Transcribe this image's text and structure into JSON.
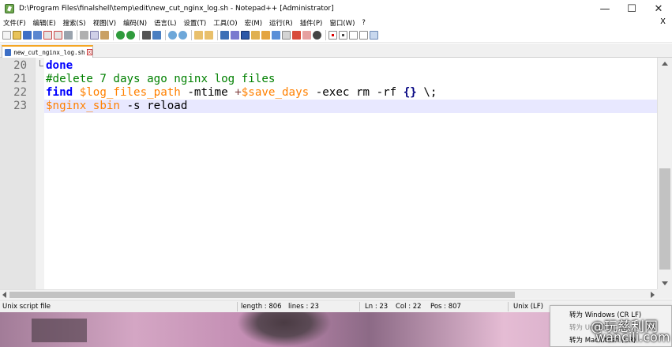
{
  "window": {
    "title": "D:\\Program Files\\finalshell\\temp\\edit\\new_cut_nginx_log.sh - Notepad++ [Administrator]",
    "minimize": "—",
    "maximize": "☐",
    "close": "✕"
  },
  "menu": {
    "items": [
      "文件(F)",
      "编辑(E)",
      "搜索(S)",
      "视图(V)",
      "编码(N)",
      "语言(L)",
      "设置(T)",
      "工具(O)",
      "宏(M)",
      "运行(R)",
      "插件(P)",
      "窗口(W)",
      "?"
    ],
    "close": "X"
  },
  "toolbar": {
    "icons": [
      "new-file-icon",
      "open-file-icon",
      "save-icon",
      "save-all-icon",
      "close-icon",
      "close-all-icon",
      "print-icon",
      "cut-icon",
      "copy-icon",
      "paste-icon",
      "undo-icon",
      "redo-icon",
      "find-icon",
      "replace-icon",
      "zoom-in-icon",
      "zoom-out-icon",
      "sync-vertical-icon",
      "sync-horizontal-icon",
      "word-wrap-icon",
      "show-all-chars-icon",
      "indent-guide-icon",
      "udl-icon",
      "doc-map-icon",
      "function-list-icon",
      "folder-workspace-icon",
      "monitoring-icon",
      "record-macro-icon",
      "stop-macro-icon",
      "play-macro-icon",
      "run-macro-icon",
      "save-macro-icon"
    ]
  },
  "tab": {
    "label": "new_cut_nginx_log.sh",
    "close": "x"
  },
  "editor": {
    "lines": [
      {
        "num": "20",
        "tokens": [
          {
            "t": "done",
            "c": "kw"
          }
        ]
      },
      {
        "num": "21",
        "tokens": [
          {
            "t": "#delete 7 days ago nginx log files",
            "c": "cm"
          }
        ]
      },
      {
        "num": "22",
        "tokens": [
          {
            "t": "find",
            "c": "kw"
          },
          {
            "t": " ",
            "c": "txt"
          },
          {
            "t": "$log_files_path",
            "c": "var"
          },
          {
            "t": " -mtime ",
            "c": "txt"
          },
          {
            "t": "+",
            "c": "op"
          },
          {
            "t": "$save_days",
            "c": "var"
          },
          {
            "t": " -exec rm -rf ",
            "c": "txt"
          },
          {
            "t": "{}",
            "c": "brace"
          },
          {
            "t": " \\;",
            "c": "txt"
          }
        ]
      },
      {
        "num": "23",
        "tokens": [
          {
            "t": "$nginx_sbin",
            "c": "var"
          },
          {
            "t": " -s reload",
            "c": "txt"
          }
        ]
      }
    ]
  },
  "status": {
    "filetype": "Unix script file",
    "length": "length : 806",
    "lines": "lines : 23",
    "ln": "Ln : 23",
    "col": "Col : 22",
    "pos": "Pos : 807",
    "eol": "Unix (LF)"
  },
  "context_menu": {
    "items": [
      {
        "label": "转为 Windows (CR LF)",
        "enabled": true
      },
      {
        "label": "转为 Unix (LF)",
        "enabled": false
      },
      {
        "label": "转为 Macintosh (CR)",
        "enabled": true
      }
    ]
  },
  "watermark": {
    "line1": "@玩慈利网",
    "line2": "wancili.com"
  },
  "colors": {
    "keyword": "#0000ff",
    "comment": "#008000",
    "variable": "#ff8000",
    "current_line": "#e8e8ff",
    "tab_accent": "#f5a623"
  }
}
